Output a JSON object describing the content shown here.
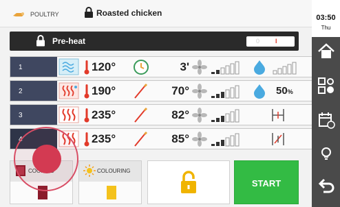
{
  "header": {
    "category_icon": "poultry-icon",
    "category": "POULTRY",
    "recipe_icon": "lock-icon",
    "recipe_title": "Roasted chicken"
  },
  "preheat": {
    "label": "Pre-heat",
    "toggle_off": "0",
    "toggle_on": "I"
  },
  "steps": [
    {
      "number": "1",
      "mode_icon": "steam-icon",
      "temperature": "120°",
      "secondary_icon": "timer-icon",
      "secondary_value": "3'",
      "fan_icon": "fan-icon",
      "fan_level": 2,
      "extra_icon": "humidity-icon",
      "extra_value": "",
      "extra_level": 0
    },
    {
      "number": "2",
      "mode_icon": "combi-heat-icon",
      "temperature": "190°",
      "secondary_icon": "core-probe-icon",
      "secondary_value": "70°",
      "fan_icon": "fan-icon",
      "fan_level": 3,
      "extra_icon": "humidity-icon",
      "extra_value": "50",
      "extra_unit": "%"
    },
    {
      "number": "3",
      "mode_icon": "convection-icon",
      "temperature": "235°",
      "secondary_icon": "core-probe-icon",
      "secondary_value": "82°",
      "fan_icon": "fan-icon",
      "fan_level": 3,
      "extra_icon": "damper-open-icon"
    },
    {
      "number": "4",
      "mode_icon": "convection-icon",
      "temperature": "235°",
      "secondary_icon": "core-probe-icon",
      "secondary_value": "85°",
      "fan_icon": "fan-icon",
      "fan_level": 3,
      "extra_icon": "damper-closed-icon"
    }
  ],
  "bottom": {
    "cooking_label": "COOKING",
    "cooking_icon": "cooking-door-icon",
    "cooking_color": "#8b1a2a",
    "colouring_label": "COLOURING",
    "colouring_icon": "sun-icon",
    "colouring_color": "#f4c21c",
    "lock_icon": "lock-icon",
    "start_label": "START"
  },
  "sidebar": {
    "time": "03:50",
    "day": "Thu",
    "items": [
      "home-icon",
      "settings-icon",
      "calendar-icon",
      "lightbulb-icon",
      "back-icon"
    ]
  },
  "colors": {
    "step_number_bg": "#3f4760",
    "start_green": "#33bb44",
    "heat_red": "#e23a2a",
    "humidity_blue": "#4aaae0",
    "sidebar_bg": "#4a4a4a"
  }
}
